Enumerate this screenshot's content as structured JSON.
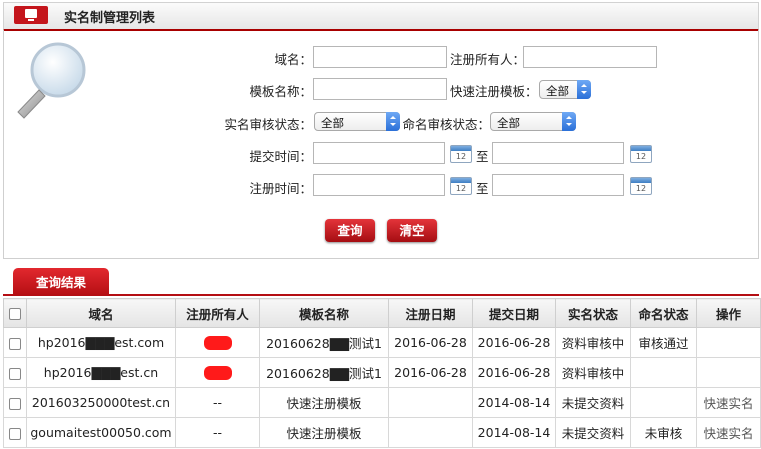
{
  "header": {
    "title": "实名制管理列表"
  },
  "form": {
    "domain_label": "域名：",
    "owner_label": "注册所有人：",
    "template_label": "模板名称：",
    "quick_template_label": "快速注册模板：",
    "quick_template_value": "全部",
    "realname_status_label": "实名审核状态：",
    "realname_status_value": "全部",
    "naming_status_label": "命名审核状态：",
    "naming_status_value": "全部",
    "submit_time_label": "提交时间：",
    "reg_time_label": "注册时间：",
    "to_label": "至",
    "calendar_day": "12",
    "query_button": "查询",
    "clear_button": "清空"
  },
  "results": {
    "tab_label": "查询结果",
    "columns": [
      "域名",
      "注册所有人",
      "模板名称",
      "注册日期",
      "提交日期",
      "实名状态",
      "命名状态",
      "操作"
    ],
    "rows": [
      {
        "domain": "hp2016▇▇▇est.com",
        "owner": "",
        "owner_redacted": true,
        "template": "20160628▇▇测试1",
        "reg_date": "2016-06-28",
        "submit_date": "2016-06-28",
        "realname_status": "资料审核中",
        "naming_status": "审核通过",
        "action": ""
      },
      {
        "domain": "hp2016▇▇▇est.cn",
        "owner": "",
        "owner_redacted": true,
        "template": "20160628▇▇测试1",
        "reg_date": "2016-06-28",
        "submit_date": "2016-06-28",
        "realname_status": "资料审核中",
        "naming_status": "",
        "action": ""
      },
      {
        "domain": "201603250000test.cn",
        "owner": "--",
        "owner_redacted": false,
        "template": "快速注册模板",
        "reg_date": "",
        "submit_date": "2014-08-14",
        "realname_status": "未提交资料",
        "naming_status": "",
        "action": "快速实名"
      },
      {
        "domain": "goumaitest00050.com",
        "owner": "--",
        "owner_redacted": false,
        "template": "快速注册模板",
        "reg_date": "",
        "submit_date": "2014-08-14",
        "realname_status": "未提交资料",
        "naming_status": "未审核",
        "action": "快速实名"
      }
    ]
  },
  "colors": {
    "accent": "#c4161c",
    "select_arrow": "#2a6fd8"
  }
}
